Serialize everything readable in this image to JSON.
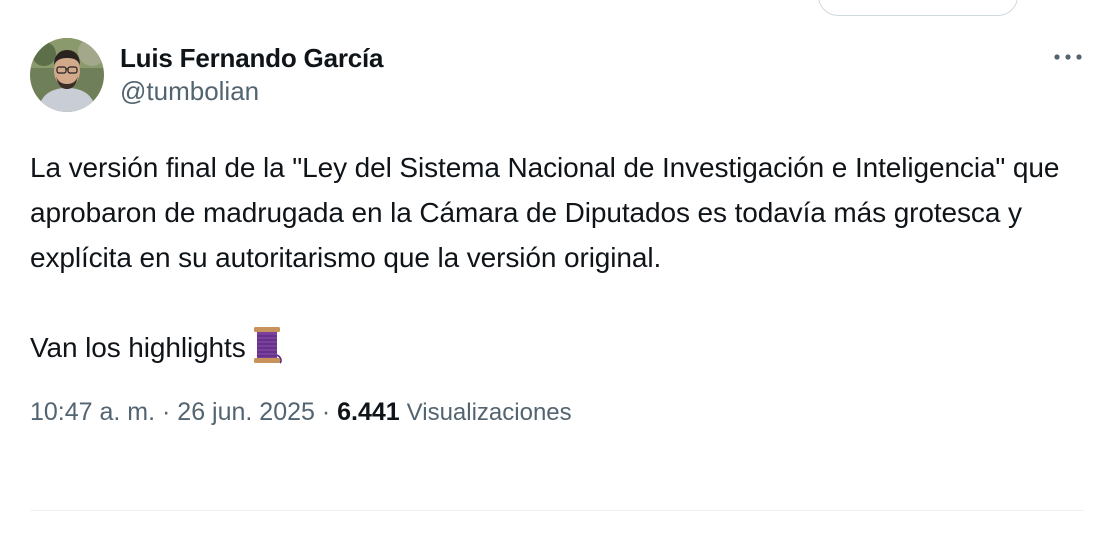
{
  "tweet": {
    "author": {
      "display_name": "Luis Fernando García",
      "handle": "@tumbolian",
      "avatar": "profile-photo"
    },
    "more_icon": "more-horizontal-icon",
    "text_paragraph_1": "La versión final de la \"Ley del Sistema Nacional de Investigación e Inteligencia\" que aprobaron de madrugada en la Cámara de Diputados es todavía más grotesca y explícita en su autoritarismo que la versión original.",
    "text_paragraph_2": "Van los highlights",
    "emoji": "thread-spool-emoji",
    "meta": {
      "time": "10:47 a. m.",
      "separator_1": " · ",
      "date": "26 jun. 2025",
      "separator_2": " · ",
      "views_count": "6.441",
      "views_label": "Visualizaciones"
    }
  },
  "colors": {
    "text_primary": "#0f1419",
    "text_secondary": "#536471",
    "border": "#cfd9de",
    "divider": "#eff3f4",
    "emoji_purple": "#7b3fa0"
  }
}
